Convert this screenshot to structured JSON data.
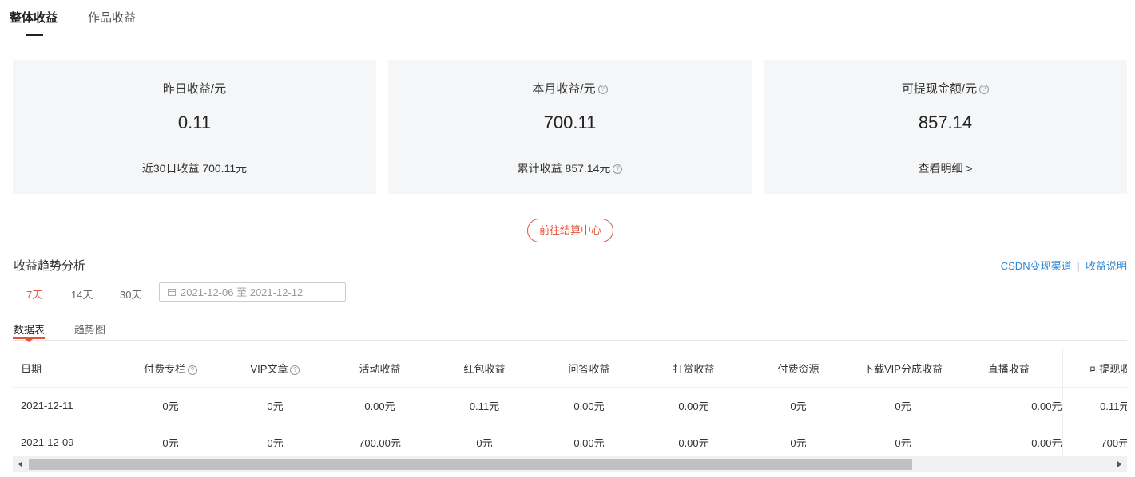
{
  "tabs": {
    "overall": "整体收益",
    "works": "作品收益"
  },
  "cards": {
    "yesterday": {
      "label": "昨日收益/元",
      "value": "0.11",
      "foot": "近30日收益 700.11元"
    },
    "month": {
      "label": "本月收益/元",
      "value": "700.11",
      "foot": "累计收益 857.14元"
    },
    "withdraw": {
      "label": "可提现金额/元",
      "value": "857.14",
      "foot": "查看明细 >"
    }
  },
  "help_glyph": "?",
  "settle_button": "前往结算中心",
  "trend": {
    "title": "收益趋势分析",
    "links": {
      "channel": "CSDN变现渠道",
      "explain": "收益说明"
    },
    "ranges": [
      "7天",
      "14天",
      "30天"
    ],
    "date_range": "2021-12-06 至 2021-12-12",
    "sub_tabs": [
      "数据表",
      "趋势图"
    ]
  },
  "table": {
    "headers": [
      "日期",
      "付费专栏",
      "VIP文章",
      "活动收益",
      "红包收益",
      "问答收益",
      "打赏收益",
      "付费资源",
      "下载VIP分成收益",
      "直播收益",
      "可提现收益"
    ],
    "rows": [
      [
        "2021-12-11",
        "0元",
        "0元",
        "0.00元",
        "0.11元",
        "0.00元",
        "0.00元",
        "0元",
        "0元",
        "0.00元",
        "0.11元"
      ],
      [
        "2021-12-09",
        "0元",
        "0元",
        "700.00元",
        "0元",
        "0.00元",
        "0.00元",
        "0元",
        "0元",
        "0.00元",
        "700元"
      ]
    ]
  },
  "colors": {
    "accent": "#e6553a",
    "link": "#2e8ad8",
    "card_bg": "#f5f6f7"
  }
}
